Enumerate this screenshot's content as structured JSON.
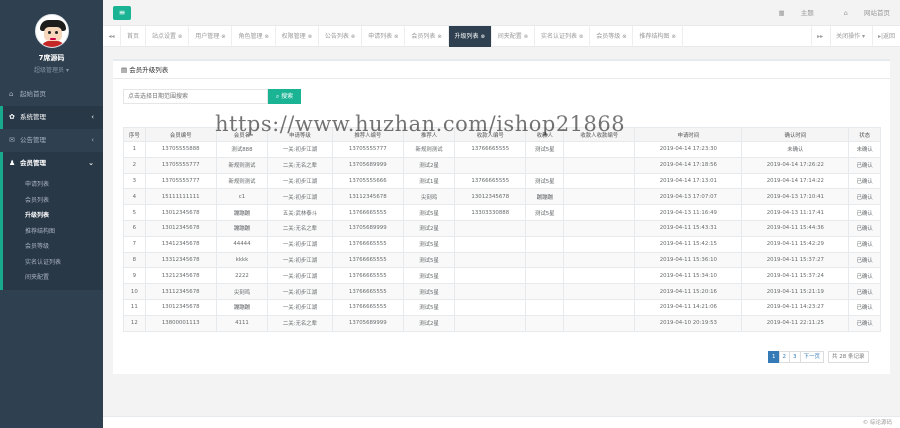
{
  "profile": {
    "name": "7席源码",
    "role": "超级管理员 ▾"
  },
  "sidebar": {
    "items": [
      {
        "label": "起始首页",
        "icon": "home-icon"
      },
      {
        "label": "系统管理",
        "icon": "gear-icon",
        "arrow": "‹"
      },
      {
        "label": "公告管理",
        "icon": "message-icon",
        "arrow": "‹"
      },
      {
        "label": "会员管理",
        "icon": "user-icon",
        "arrow": "⌄"
      }
    ],
    "submenu": [
      "申请列表",
      "会员列表",
      "升级列表",
      "推荐结构图",
      "会员等级",
      "实名认证列表",
      "间夹配置"
    ]
  },
  "topbar": {
    "toggle": "≡",
    "theme": "主题",
    "home": "网站首页"
  },
  "tabs": {
    "items": [
      "首页",
      "站点设置",
      "用户管理",
      "角色管理",
      "权限管理",
      "公告列表",
      "申请列表",
      "会员列表",
      "升级列表",
      "间夹配置",
      "实名认证列表",
      "会员等级",
      "推荐结构图"
    ],
    "active_index": 8,
    "ops": "关闭操作 ▾",
    "back": "▸|返回"
  },
  "panel": {
    "title": "会员升级列表",
    "search_placeholder": "点击选择日期范围搜索",
    "search_button": "搜索"
  },
  "table": {
    "headers": [
      "序号",
      "会员编号",
      "会员名",
      "申请等级",
      "推荐人编号",
      "推荐人",
      "收款人编号",
      "收款人",
      "收款人收款编号",
      "申请时间",
      "确认时间",
      "状态"
    ],
    "rows": [
      [
        "1",
        "13705555888",
        "测试888",
        "一关:初步江湖",
        "13705555777",
        "新规则测试",
        "13766665555",
        "测试5星",
        "",
        "2019-04-14 17:23:30",
        "未确认",
        "未确认"
      ],
      [
        "2",
        "13705555777",
        "新规则测试",
        "二关:无名之辈",
        "13705689999",
        "测试2星",
        "",
        "",
        "",
        "2019-04-14 17:18:56",
        "2019-04-14 17:26:22",
        "已确认"
      ],
      [
        "3",
        "13705555777",
        "新规则测试",
        "一关:初步江湖",
        "13705555666",
        "测试1星",
        "13766665555",
        "测试5星",
        "",
        "2019-04-14 17:13:01",
        "2019-04-14 17:14:22",
        "已确认"
      ],
      [
        "4",
        "15111111111",
        "c1",
        "一关:初步江湖",
        "13112345678",
        "尖刻鸡",
        "13012345678",
        "蹦蹦蹦",
        "",
        "2019-04-13 17:07:07",
        "2019-04-13 17:10:41",
        "已确认"
      ],
      [
        "5",
        "13012345678",
        "蹦蹦蹦",
        "五关:武林泰斗",
        "13766665555",
        "测试5星",
        "13303330888",
        "测试5星",
        "",
        "2019-04-13 11:16:49",
        "2019-04-13 11:17:41",
        "已确认"
      ],
      [
        "6",
        "13012345678",
        "蹦蹦蹦",
        "二关:无名之辈",
        "13705689999",
        "测试2星",
        "",
        "",
        "",
        "2019-04-11 15:43:31",
        "2019-04-11 15:44:36",
        "已确认"
      ],
      [
        "7",
        "13412345678",
        "44444",
        "一关:初步江湖",
        "13766665555",
        "测试5星",
        "",
        "",
        "",
        "2019-04-11 15:42:15",
        "2019-04-11 15:42:29",
        "已确认"
      ],
      [
        "8",
        "13312345678",
        "kkkk",
        "一关:初步江湖",
        "13766665555",
        "测试5星",
        "",
        "",
        "",
        "2019-04-11 15:36:10",
        "2019-04-11 15:37:27",
        "已确认"
      ],
      [
        "9",
        "13212345678",
        "2222",
        "一关:初步江湖",
        "13766665555",
        "测试5星",
        "",
        "",
        "",
        "2019-04-11 15:34:10",
        "2019-04-11 15:37:24",
        "已确认"
      ],
      [
        "10",
        "13112345678",
        "尖刻鸡",
        "一关:初步江湖",
        "13766665555",
        "测试5星",
        "",
        "",
        "",
        "2019-04-11 15:20:16",
        "2019-04-11 15:21:19",
        "已确认"
      ],
      [
        "11",
        "13012345678",
        "蹦蹦蹦",
        "一关:初步江湖",
        "13766665555",
        "测试5星",
        "",
        "",
        "",
        "2019-04-11 14:21:06",
        "2019-04-11 14:23:27",
        "已确认"
      ],
      [
        "12",
        "13800001113",
        "4111",
        "二关:无名之辈",
        "13705689999",
        "测试2星",
        "",
        "",
        "",
        "2019-04-10 20:19:53",
        "2019-04-11 22:11:25",
        "已确认"
      ]
    ]
  },
  "pagination": {
    "pages": [
      "1",
      "2",
      "3"
    ],
    "current": "1",
    "next": "下一页",
    "total": "共 28 条记录"
  },
  "footer": "© 综论源码",
  "watermark": "https://www.huzhan.com/ishop21868",
  "colors": {
    "sidebar": "#2f4050",
    "accent": "#1ab394",
    "active_tab": "#2f4050",
    "page_current": "#337ab7"
  }
}
